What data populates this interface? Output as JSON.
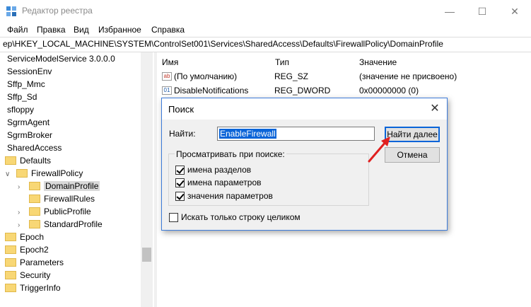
{
  "window": {
    "title": "Редактор реестра"
  },
  "menu": [
    "Файл",
    "Правка",
    "Вид",
    "Избранное",
    "Справка"
  ],
  "address": "ep\\HKEY_LOCAL_MACHINE\\SYSTEM\\ControlSet001\\Services\\SharedAccess\\Defaults\\FirewallPolicy\\DomainProfile",
  "tree": {
    "items": [
      {
        "label": "ServiceModelService 3.0.0.0",
        "type": "plain"
      },
      {
        "label": "SessionEnv",
        "type": "plain"
      },
      {
        "label": "Sffp_Mmc",
        "type": "plain"
      },
      {
        "label": "Sffp_Sd",
        "type": "plain"
      },
      {
        "label": "sfloppy",
        "type": "plain"
      },
      {
        "label": "SgrmAgent",
        "type": "plain"
      },
      {
        "label": "SgrmBroker",
        "type": "plain"
      },
      {
        "label": "SharedAccess",
        "type": "plain"
      },
      {
        "label": "Defaults",
        "type": "folder"
      },
      {
        "label": "FirewallPolicy",
        "type": "folder"
      },
      {
        "label": "DomainProfile",
        "type": "folder",
        "selected": true
      },
      {
        "label": "FirewallRules",
        "type": "folder"
      },
      {
        "label": "PublicProfile",
        "type": "folder"
      },
      {
        "label": "StandardProfile",
        "type": "folder"
      },
      {
        "label": "Epoch",
        "type": "folder"
      },
      {
        "label": "Epoch2",
        "type": "folder"
      },
      {
        "label": "Parameters",
        "type": "folder"
      },
      {
        "label": "Security",
        "type": "folder"
      },
      {
        "label": "TriggerInfo",
        "type": "folder"
      }
    ]
  },
  "list": {
    "columns": [
      "Имя",
      "Тип",
      "Значение"
    ],
    "rows": [
      {
        "icon": "ab",
        "name": "(По умолчанию)",
        "type": "REG_SZ",
        "value": "(значение не присвоено)"
      },
      {
        "icon": "bin",
        "name": "DisableNotifications",
        "type": "REG_DWORD",
        "value": "0x00000000 (0)"
      }
    ]
  },
  "dialog": {
    "title": "Поиск",
    "find_label": "Найти:",
    "find_value": "EnableFirewall",
    "find_next": "Найти далее",
    "cancel": "Отмена",
    "lookin_legend": "Просматривать при поиске:",
    "options": [
      {
        "label": "имена разделов",
        "checked": true
      },
      {
        "label": "имена параметров",
        "checked": true
      },
      {
        "label": "значения параметров",
        "checked": true
      }
    ],
    "whole_string": {
      "label": "Искать только строку целиком",
      "checked": false
    }
  }
}
